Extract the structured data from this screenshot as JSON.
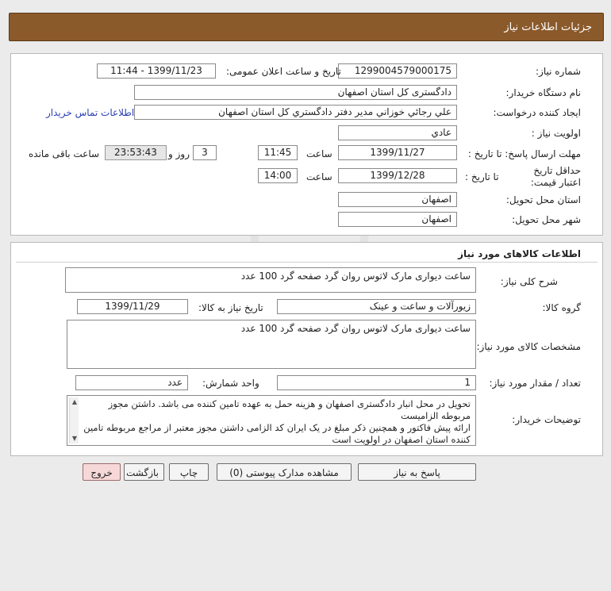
{
  "header": {
    "title": "جزئیات اطلاعات نیاز"
  },
  "details": {
    "need_number_label": "شماره نیاز:",
    "need_number": "1299004579000175",
    "announce_label": "تاریخ و ساعت اعلان عمومی:",
    "announce_value": "1399/11/23 - 11:44",
    "buyer_org_label": "نام دستگاه خریدار:",
    "buyer_org": "دادگستری کل استان اصفهان",
    "creator_label": "ایجاد کننده درخواست:",
    "creator": "علي رجائي خوزاني مدير دفتر دادگستري كل استان اصفهان",
    "contact_link": "اطلاعات تماس خریدار",
    "priority_label": "اولویت نیاز :",
    "priority": "عادي",
    "deadline_label": "مهلت ارسال پاسخ: تا تاریخ :",
    "deadline_date": "1399/11/27",
    "time_label": "ساعت",
    "deadline_time": "11:45",
    "days_value": "3",
    "days_label": "روز و",
    "remaining_time": "23:53:43",
    "remaining_label": "ساعت باقی مانده",
    "price_validity_label": "حداقل تاریخ اعتبار قیمت:",
    "price_validity_until": "تا تاریخ :",
    "price_validity_date": "1399/12/28",
    "price_validity_time": "14:00",
    "province_label": "استان محل تحویل:",
    "province": "اصفهان",
    "city_label": "شهر محل تحویل:",
    "city": "اصفهان"
  },
  "goods": {
    "section_title": "اطلاعات کالاهای مورد نیاز",
    "summary_label": "شرح کلی نیاز:",
    "summary": "ساعت دیواری مارک لاتوس روان گرد صفحه گرد 100 عدد",
    "group_label": "گروه کالا:",
    "group": "زیورآلات و ساعت و عینک",
    "need_date_label": "تاریخ نیاز به کالا:",
    "need_date": "1399/11/29",
    "specs_label": "مشخصات کالای مورد نیاز:",
    "specs": "ساعت دیواری مارک لاتوس روان گرد صفحه گرد 100 عدد",
    "quantity_label": "تعداد / مقدار مورد نیاز:",
    "quantity": "1",
    "unit_label": "واحد شمارش:",
    "unit": "عدد",
    "buyer_notes_label": "توضیحات خریدار:",
    "buyer_notes_1": "تحویل در محل انبار دادگستری اصفهان و هزینه حمل به عهده تامین کننده می باشد. داشتن مجوز مربوطه الزامیست",
    "buyer_notes_2": "ارائه پیش فاکتور و همچنین ذکر مبلغ در یک ایران کد الزامی  داشتن مجوز معتبر از مراجع مربوطه تامین کننده استان اصفهان در اولویت است"
  },
  "actions": {
    "reply": "پاسخ به نیاز",
    "view_docs": "مشاهده مدارک پیوستی (0)",
    "print": "چاپ",
    "back": "بازگشت",
    "exit": "خروج"
  },
  "colors": {
    "title_bar": "#8b5a2b",
    "link": "#2b3fb5",
    "exit_button": "#f7d8d8"
  }
}
